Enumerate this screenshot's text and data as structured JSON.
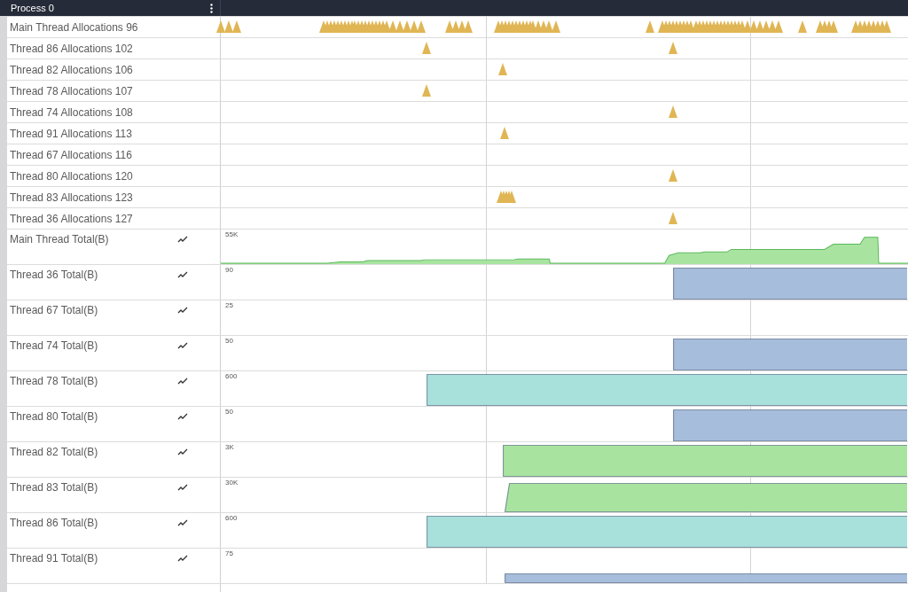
{
  "header": {
    "title": "Process 0"
  },
  "allocation_tracks": [
    {
      "label": "Main Thread Allocations 96"
    },
    {
      "label": "Thread 86 Allocations 102"
    },
    {
      "label": "Thread 82 Allocations 106"
    },
    {
      "label": "Thread 78 Allocations 107"
    },
    {
      "label": "Thread 74 Allocations 108"
    },
    {
      "label": "Thread 91 Allocations 113"
    },
    {
      "label": "Thread 67 Allocations 116"
    },
    {
      "label": "Thread 80 Allocations 120"
    },
    {
      "label": "Thread 83 Allocations 123"
    },
    {
      "label": "Thread 36 Allocations 127"
    }
  ],
  "counter_tracks": [
    {
      "label": "Main Thread Total(B)",
      "scale": "55K",
      "color": "#a8e4a0"
    },
    {
      "label": "Thread 36 Total(B)",
      "scale": "90",
      "color": "#a6bddb"
    },
    {
      "label": "Thread 67 Total(B)",
      "scale": "25"
    },
    {
      "label": "Thread 74 Total(B)",
      "scale": "50",
      "color": "#a6bddb"
    },
    {
      "label": "Thread 78 Total(B)",
      "scale": "600",
      "color": "#a8e0dc"
    },
    {
      "label": "Thread 80 Total(B)",
      "scale": "50",
      "color": "#a6bddb"
    },
    {
      "label": "Thread 82 Total(B)",
      "scale": "3K",
      "color": "#a8e4a0"
    },
    {
      "label": "Thread 83 Total(B)",
      "scale": "30K",
      "color": "#a8e4a0"
    },
    {
      "label": "Thread 86 Total(B)",
      "scale": "600",
      "color": "#a8e0dc"
    },
    {
      "label": "Thread 91 Total(B)",
      "scale": "75",
      "color": "#a6bddb"
    }
  ]
}
